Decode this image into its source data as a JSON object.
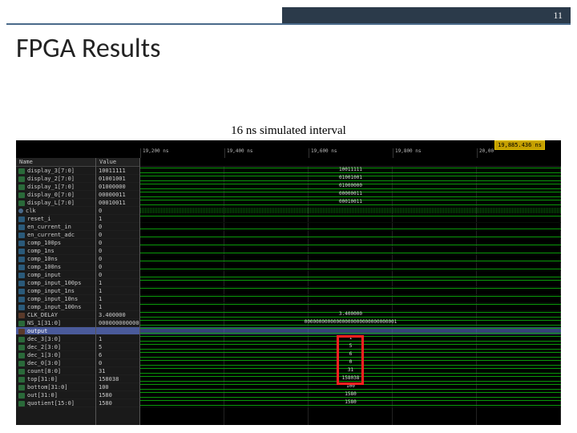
{
  "slide": {
    "page_number": "11",
    "title": "FPGA Results",
    "subtitle": "16 ns simulated interval"
  },
  "viewer": {
    "cursor_readout": "19,885.436 ns",
    "col_headers": {
      "name": "Name",
      "value": "Value"
    },
    "time_ticks": [
      "19,200 ns",
      "19,400 ns",
      "19,600 ns",
      "19,800 ns",
      "20,00"
    ],
    "signals": [
      {
        "name": "display_3[7:0]",
        "value": "10011111",
        "type": "bus",
        "wave_label": "10011111"
      },
      {
        "name": "display_2[7:0]",
        "value": "01001001",
        "type": "bus",
        "wave_label": "01001001"
      },
      {
        "name": "display_1[7:0]",
        "value": "01000000",
        "type": "bus",
        "wave_label": "01000000"
      },
      {
        "name": "display_0[7:0]",
        "value": "00000011",
        "type": "bus",
        "wave_label": "00000011"
      },
      {
        "name": "display_L[7:0]",
        "value": "00010011",
        "type": "bus",
        "wave_label": "00010011"
      },
      {
        "name": "clk",
        "value": "0",
        "type": "clock"
      },
      {
        "name": "reset_i",
        "value": "1",
        "type": "single",
        "wave": "high"
      },
      {
        "name": "en_current_in",
        "value": "0",
        "type": "single",
        "wave": "low"
      },
      {
        "name": "en_current_adc",
        "value": "0",
        "type": "single",
        "wave": "low"
      },
      {
        "name": "comp_100ps",
        "value": "0",
        "type": "single",
        "wave": "low"
      },
      {
        "name": "comp_1ns",
        "value": "0",
        "type": "single",
        "wave": "low"
      },
      {
        "name": "comp_10ns",
        "value": "0",
        "type": "single",
        "wave": "low"
      },
      {
        "name": "comp_100ns",
        "value": "0",
        "type": "single",
        "wave": "low"
      },
      {
        "name": "comp_input",
        "value": "0",
        "type": "single",
        "wave": "low"
      },
      {
        "name": "comp_input_100ps",
        "value": "1",
        "type": "single",
        "wave": "high"
      },
      {
        "name": "comp_input_1ns",
        "value": "1",
        "type": "single",
        "wave": "high"
      },
      {
        "name": "comp_input_10ns",
        "value": "1",
        "type": "single",
        "wave": "high"
      },
      {
        "name": "comp_input_100ns",
        "value": "1",
        "type": "single",
        "wave": "high"
      },
      {
        "name": "CLK_DELAY",
        "value": "3.400000",
        "type": "grp",
        "wave_label": "3.400000"
      },
      {
        "name": "NS_1[31:0]",
        "value": "000000000000000…",
        "type": "bus",
        "wave_label": "00000000000000000000000000000001"
      },
      {
        "name": "output",
        "value": "",
        "type": "grp",
        "highlight": true
      },
      {
        "name": "dec_3[3:0]",
        "value": "1",
        "type": "bus",
        "wave_label": "1"
      },
      {
        "name": "dec_2[3:0]",
        "value": "5",
        "type": "bus",
        "wave_label": "5"
      },
      {
        "name": "dec_1[3:0]",
        "value": "6",
        "type": "bus",
        "wave_label": "6"
      },
      {
        "name": "dec_0[3:0]",
        "value": "0",
        "type": "bus",
        "wave_label": "0"
      },
      {
        "name": "count[8:0]",
        "value": "31",
        "type": "bus",
        "wave_label": "31"
      },
      {
        "name": "top[31:0]",
        "value": "158038",
        "type": "bus",
        "wave_label": "158038"
      },
      {
        "name": "bottom[31:0]",
        "value": "100",
        "type": "bus",
        "wave_label": "100"
      },
      {
        "name": "out[31:0]",
        "value": "1580",
        "type": "bus",
        "wave_label": "1580"
      },
      {
        "name": "quotient[15:0]",
        "value": "1580",
        "type": "bus",
        "wave_label": "1580"
      }
    ]
  }
}
